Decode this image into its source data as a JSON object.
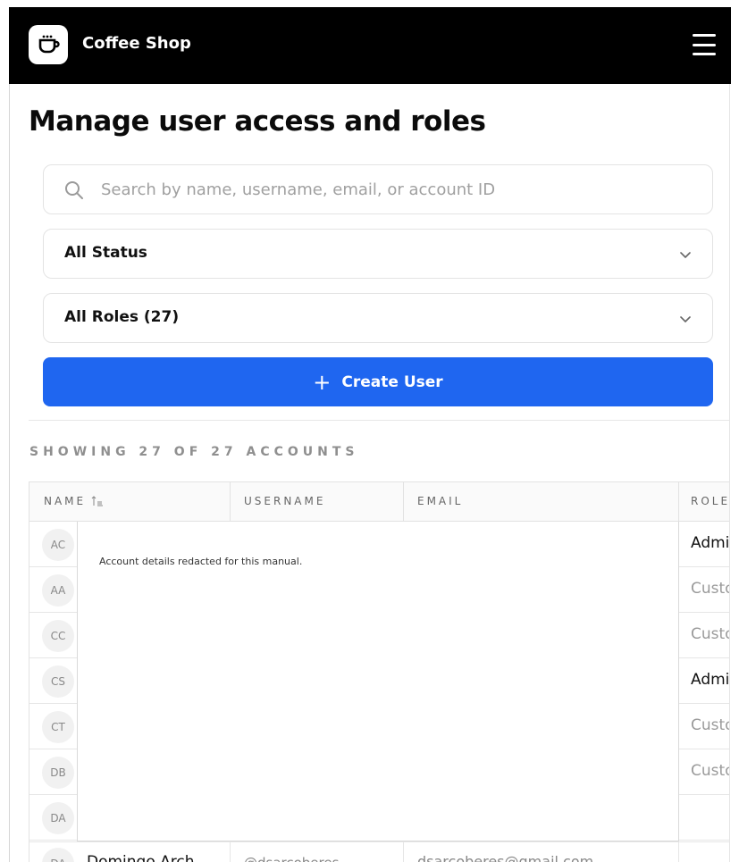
{
  "header": {
    "app_name": "Coffee Shop",
    "logo_icon": "coffee-cup-icon",
    "menu_icon": "hamburger-menu-icon"
  },
  "page": {
    "title": "Manage user access and roles"
  },
  "filters": {
    "search_placeholder": "Search by name, username, email, or account ID",
    "search_value": "",
    "status_selected": "All Status",
    "roles_selected": "All Roles (27)"
  },
  "actions": {
    "create_user_label": "Create User",
    "create_user_icon": "plus-icon"
  },
  "summary": {
    "showing_text": "SHOWING 27 OF 27 ACCOUNTS"
  },
  "table": {
    "columns": [
      "NAME",
      "USERNAME",
      "EMAIL",
      "ROLE"
    ],
    "sort_column": "NAME",
    "rows": [
      {
        "initials": "AC",
        "role": "Admin"
      },
      {
        "initials": "AA",
        "role": "Customer"
      },
      {
        "initials": "CC",
        "role": "Customer"
      },
      {
        "initials": "CS",
        "role": "Admin"
      },
      {
        "initials": "CT",
        "role": "Customer"
      },
      {
        "initials": "DB",
        "role": "Customer"
      },
      {
        "initials": "DA",
        "role": ""
      }
    ],
    "redaction_note": "Account details redacted for this manual.",
    "partial_row": {
      "initials": "DA",
      "name": "Domingo Arch",
      "username": "@dsarcoberes",
      "email": "dsarcoberes@gmail.com"
    }
  },
  "colors": {
    "header_bg": "#000000",
    "primary": "#1f66f0",
    "admin_role": "#111111",
    "customer_role": "#9a9a9a"
  }
}
